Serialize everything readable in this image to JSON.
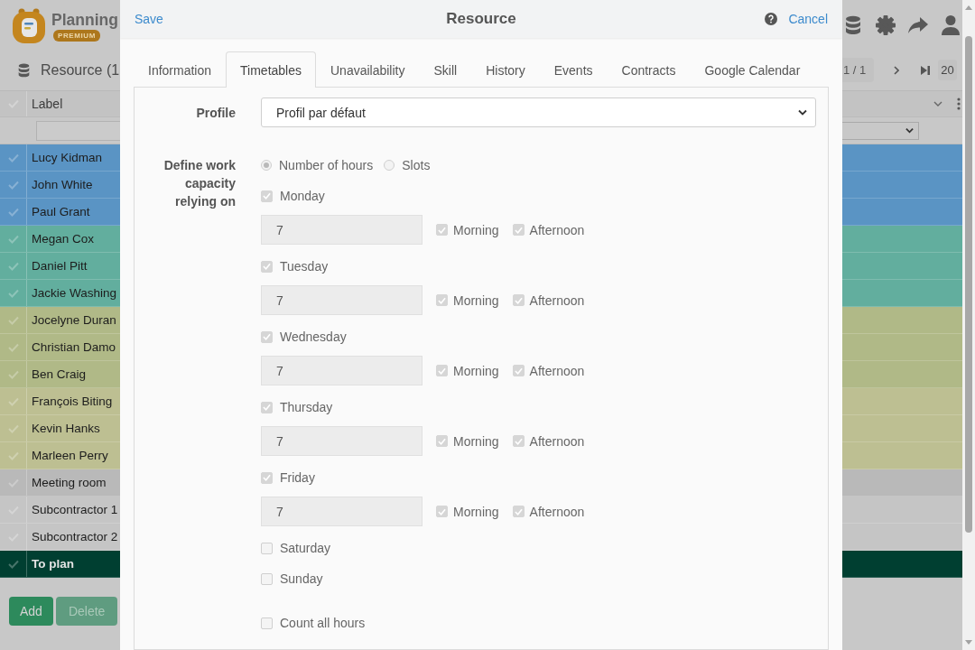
{
  "app": {
    "brand": {
      "name": "Planning",
      "badge": "PREMIUM"
    },
    "page_title": "Resource (1",
    "pagination": {
      "page": "1 / 1",
      "page_size": "20"
    },
    "table": {
      "columns": [
        "Label"
      ],
      "rows": [
        {
          "label": "Lucy Kidman",
          "kind": "resource",
          "color": "#5a94c4"
        },
        {
          "label": "John White",
          "kind": "resource",
          "color": "#5a94c4"
        },
        {
          "label": "Paul Grant",
          "kind": "resource",
          "color": "#5a94c4"
        },
        {
          "label": "Megan Cox",
          "kind": "resource",
          "color": "#62ae9e"
        },
        {
          "label": "Daniel Pitt",
          "kind": "resource",
          "color": "#62ae9e"
        },
        {
          "label": "Jackie Washing",
          "kind": "resource",
          "color": "#62ae9e"
        },
        {
          "label": "Jocelyne Duran",
          "kind": "resource",
          "color": "#b0b987"
        },
        {
          "label": "Christian Damo",
          "kind": "resource",
          "color": "#b0b987"
        },
        {
          "label": "Ben Craig",
          "kind": "resource",
          "color": "#b0b987"
        },
        {
          "label": "François Biting",
          "kind": "resource",
          "color": "#bdbf92"
        },
        {
          "label": "Kevin Hanks",
          "kind": "resource",
          "color": "#bdbf92"
        },
        {
          "label": "Marleen Perry",
          "kind": "resource",
          "color": "#bdbf92"
        },
        {
          "label": "Meeting room",
          "kind": "resource",
          "color": "#b9b9b9"
        },
        {
          "label": "Subcontractor 1",
          "kind": "resource",
          "color": "#c5c5c5"
        },
        {
          "label": "Subcontractor 2",
          "kind": "resource",
          "color": "#c5c5c5"
        },
        {
          "label": "To plan",
          "kind": "summary",
          "color": "#003f31"
        }
      ]
    },
    "buttons": [
      {
        "label": "Add",
        "disabled": false
      },
      {
        "label": "Delete",
        "disabled": true
      }
    ]
  },
  "dialog": {
    "save": "Save",
    "title": "Resource",
    "cancel": "Cancel",
    "tabs": [
      {
        "label": "Information",
        "selected": false
      },
      {
        "label": "Timetables",
        "selected": true
      },
      {
        "label": "Unavailability",
        "selected": false
      },
      {
        "label": "Skill",
        "selected": false
      },
      {
        "label": "History",
        "selected": false
      },
      {
        "label": "Events",
        "selected": false
      },
      {
        "label": "Contracts",
        "selected": false
      },
      {
        "label": "Google Calendar",
        "selected": false
      }
    ],
    "profile": {
      "label": "Profile",
      "value": "Profil par défaut"
    },
    "capacity": {
      "label": "Define work capacity relying on",
      "disabled": true,
      "modes": [
        {
          "label": "Number of hours",
          "selected": true
        },
        {
          "label": "Slots",
          "selected": false
        }
      ],
      "days": [
        {
          "label": "Monday",
          "checked": true,
          "hours": "7",
          "periods": [
            {
              "label": "Morning",
              "checked": true
            },
            {
              "label": "Afternoon",
              "checked": true
            }
          ]
        },
        {
          "label": "Tuesday",
          "checked": true,
          "hours": "7",
          "periods": [
            {
              "label": "Morning",
              "checked": true
            },
            {
              "label": "Afternoon",
              "checked": true
            }
          ]
        },
        {
          "label": "Wednesday",
          "checked": true,
          "hours": "7",
          "periods": [
            {
              "label": "Morning",
              "checked": true
            },
            {
              "label": "Afternoon",
              "checked": true
            }
          ]
        },
        {
          "label": "Thursday",
          "checked": true,
          "hours": "7",
          "periods": [
            {
              "label": "Morning",
              "checked": true
            },
            {
              "label": "Afternoon",
              "checked": true
            }
          ]
        },
        {
          "label": "Friday",
          "checked": true,
          "hours": "7",
          "periods": [
            {
              "label": "Morning",
              "checked": true
            },
            {
              "label": "Afternoon",
              "checked": true
            }
          ]
        },
        {
          "label": "Saturday",
          "checked": false
        },
        {
          "label": "Sunday",
          "checked": false
        }
      ],
      "count_all_hours": {
        "label": "Count all hours",
        "checked": false
      }
    }
  }
}
